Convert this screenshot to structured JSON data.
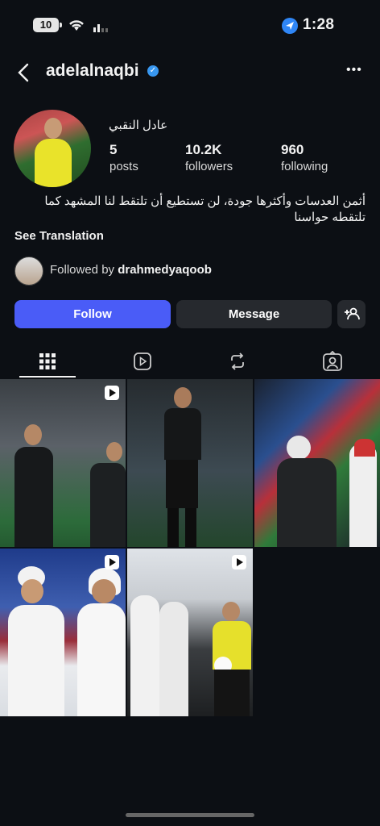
{
  "status_bar": {
    "time": "1:28",
    "battery": "10"
  },
  "header": {
    "username": "adelalnaqbi",
    "more_label": "•••"
  },
  "profile": {
    "display_name": "عادل النقبي",
    "stats": [
      {
        "value": "5",
        "label": "posts"
      },
      {
        "value": "10.2K",
        "label": "followers"
      },
      {
        "value": "960",
        "label": "following"
      }
    ],
    "bio": "أثمن العدسات وأكثرها جودة، لن تستطيع أن تلتقط لنا المشهد كما تلتقطه حواسنا",
    "see_translation": "See Translation",
    "followed_by_prefix": "Followed by",
    "followed_by_user": "drahmedyaqoob"
  },
  "actions": {
    "follow": "Follow",
    "message": "Message"
  },
  "tabs": [
    "grid-icon",
    "reels-icon",
    "reposts-icon",
    "tagged-icon"
  ],
  "colors": {
    "background": "#0c0f14",
    "follow": "#4a5cf7",
    "verified": "#3897f0"
  }
}
